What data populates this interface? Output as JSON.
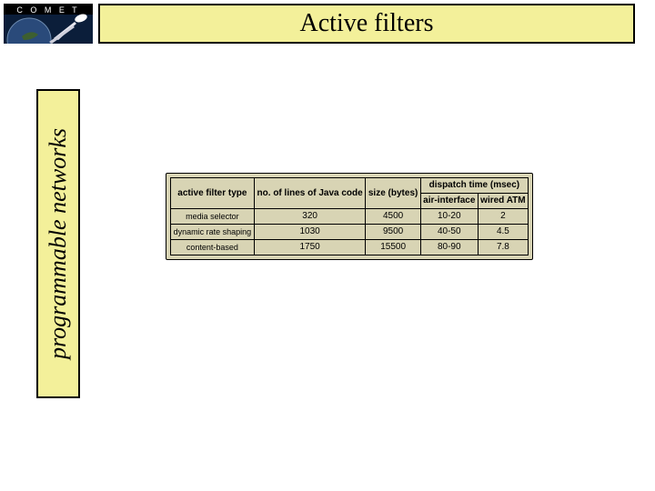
{
  "logo_text": "C O M E T",
  "title": "Active filters",
  "sidebar_label": "programmable networks",
  "table": {
    "headers": {
      "c1": "active filter type",
      "c2": "no. of lines of Java code",
      "c3": "size (bytes)",
      "c4": "dispatch time (msec)",
      "c4a": "air-interface",
      "c4b": "wired ATM"
    },
    "rows": [
      {
        "label": "media selector",
        "lines": "320",
        "bytes": "4500",
        "air": "10-20",
        "atm": "2"
      },
      {
        "label": "dynamic rate shaping",
        "lines": "1030",
        "bytes": "9500",
        "air": "40-50",
        "atm": "4.5"
      },
      {
        "label": "content-based",
        "lines": "1750",
        "bytes": "15500",
        "air": "80-90",
        "atm": "7.8"
      }
    ]
  },
  "chart_data": {
    "type": "table",
    "title": "Active filters",
    "columns": [
      "active filter type",
      "no. of lines of Java code",
      "size (bytes)",
      "dispatch time air-interface (msec)",
      "dispatch time wired ATM (msec)"
    ],
    "rows": [
      [
        "media selector",
        320,
        4500,
        "10-20",
        2
      ],
      [
        "dynamic rate shaping",
        1030,
        9500,
        "40-50",
        4.5
      ],
      [
        "content-based",
        1750,
        15500,
        "80-90",
        7.8
      ]
    ]
  }
}
